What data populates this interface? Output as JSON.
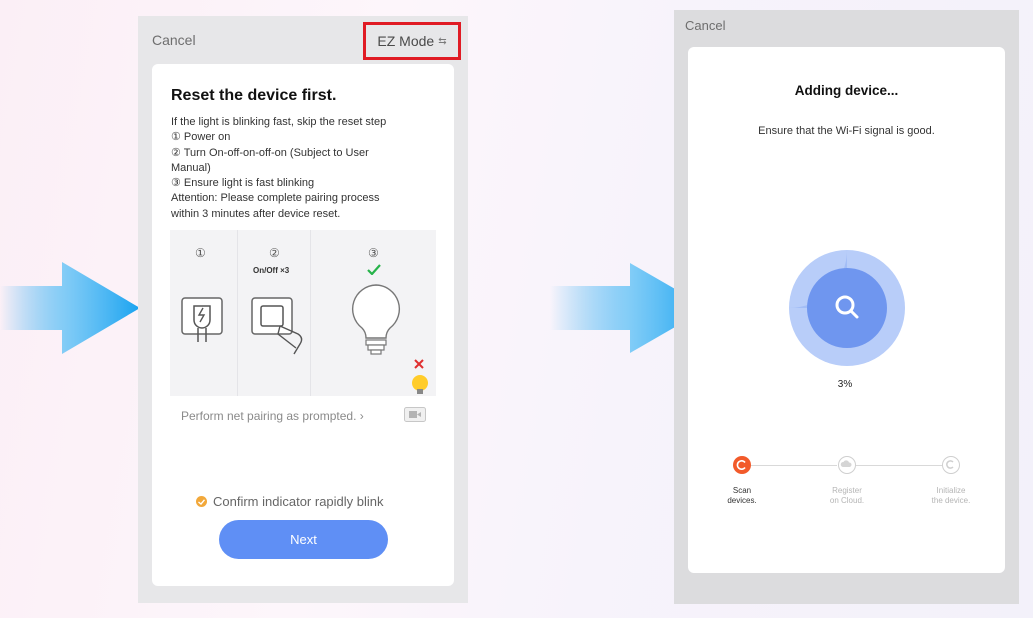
{
  "left_screen": {
    "cancel_label": "Cancel",
    "mode_label": "EZ Mode",
    "mode_swap_icon": "swap-arrows-icon",
    "title": "Reset the device first.",
    "instructions": [
      "If the light is blinking fast, skip the reset step",
      "① Power on",
      "② Turn On-off-on-off-on (Subject to User",
      "Manual)",
      "③ Ensure light is fast blinking",
      "Attention: Please complete pairing process",
      "within 3 minutes after device reset."
    ],
    "illustration": {
      "step1": "①",
      "step2": "②",
      "step2_caption": "On/Off ×3",
      "step3": "③"
    },
    "pairing_prompt": "Perform net pairing as prompted.",
    "pairing_chevron": "›",
    "confirm_label": "Confirm indicator rapidly blink",
    "next_label": "Next"
  },
  "right_screen": {
    "cancel_label": "Cancel",
    "title": "Adding device...",
    "subtitle": "Ensure that the Wi-Fi signal is good.",
    "progress": 3,
    "progress_label": "3%",
    "steps": [
      {
        "line1": "Scan",
        "line2": "devices.",
        "state": "active"
      },
      {
        "line1": "Register",
        "line2": "on Cloud.",
        "state": "pending"
      },
      {
        "line1": "Initialize",
        "line2": "the device.",
        "state": "pending"
      }
    ]
  },
  "colors": {
    "arrow_blue": "#1aa3f0",
    "accent_blue": "#5f8ff5",
    "highlight_red": "#e01b24",
    "active_step": "#f25a2a",
    "confirm_yellow": "#f2a83a"
  }
}
